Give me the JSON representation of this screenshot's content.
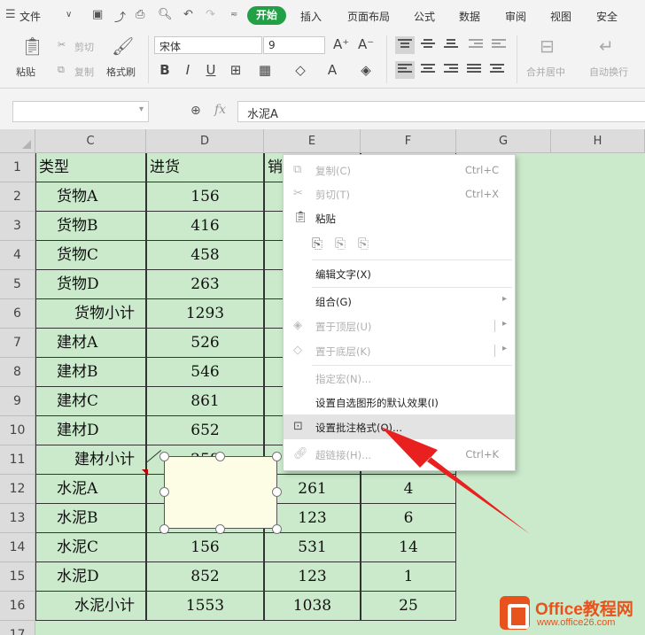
{
  "ribbon": {
    "menu": [
      "文件",
      "开始",
      "插入",
      "页面布局",
      "公式",
      "数据",
      "审阅",
      "视图",
      "安全"
    ],
    "clipboard": {
      "paste": "粘贴",
      "cut": "剪切",
      "copy": "复制",
      "format_painter": "格式刷"
    },
    "font_name": "宋体",
    "font_size": "9",
    "merge_center": "合并居中",
    "wrap_text": "自动换行"
  },
  "formula_bar": {
    "name_box": "",
    "fx": "fx",
    "formula": "水泥A"
  },
  "columns": [
    "C",
    "D",
    "E",
    "F",
    "G",
    "H"
  ],
  "rows": [
    "1",
    "2",
    "3",
    "4",
    "5",
    "6",
    "7",
    "8",
    "9",
    "10",
    "11",
    "12",
    "13",
    "14",
    "15",
    "16",
    "17"
  ],
  "table": {
    "header": [
      "类型",
      "进货",
      "销"
    ],
    "body": [
      [
        "货物A",
        "156",
        "",
        ""
      ],
      [
        "货物B",
        "416",
        "",
        ""
      ],
      [
        "货物C",
        "458",
        "",
        ""
      ],
      [
        "货物D",
        "263",
        "",
        ""
      ],
      [
        "货物小计",
        "1293",
        "",
        ""
      ],
      [
        "建材A",
        "526",
        "",
        ""
      ],
      [
        "建材B",
        "546",
        "",
        ""
      ],
      [
        "建材C",
        "861",
        "",
        ""
      ],
      [
        "建材D",
        "652",
        "",
        ""
      ],
      [
        "建材小计",
        "258",
        "",
        ""
      ],
      [
        "水泥A",
        "",
        "261",
        "4"
      ],
      [
        "水泥B",
        "",
        "123",
        "6"
      ],
      [
        "水泥C",
        "156",
        "531",
        "14"
      ],
      [
        "水泥D",
        "852",
        "123",
        "1"
      ],
      [
        "水泥小计",
        "1553",
        "1038",
        "25"
      ]
    ]
  },
  "context_menu": {
    "copy": "复制(C)",
    "copy_sc": "Ctrl+C",
    "cut": "剪切(T)",
    "cut_sc": "Ctrl+X",
    "paste": "粘贴",
    "edit_text": "编辑文字(X)",
    "group": "组合(G)",
    "bring_front": "置于顶层(U)",
    "send_back": "置于底层(K)",
    "assign_macro": "指定宏(N)...",
    "default_effect": "设置自选图形的默认效果(I)",
    "format_comment": "设置批注格式(O)...",
    "hyperlink": "超链接(H)...",
    "hyperlink_sc": "Ctrl+K"
  },
  "watermark": {
    "title": "Office教程网",
    "url": "www.office26.com"
  },
  "colors": {
    "accent": "#22a045",
    "grid_bg": "#cbeacc",
    "arrow": "#e82020",
    "brand": "#e8531d"
  }
}
